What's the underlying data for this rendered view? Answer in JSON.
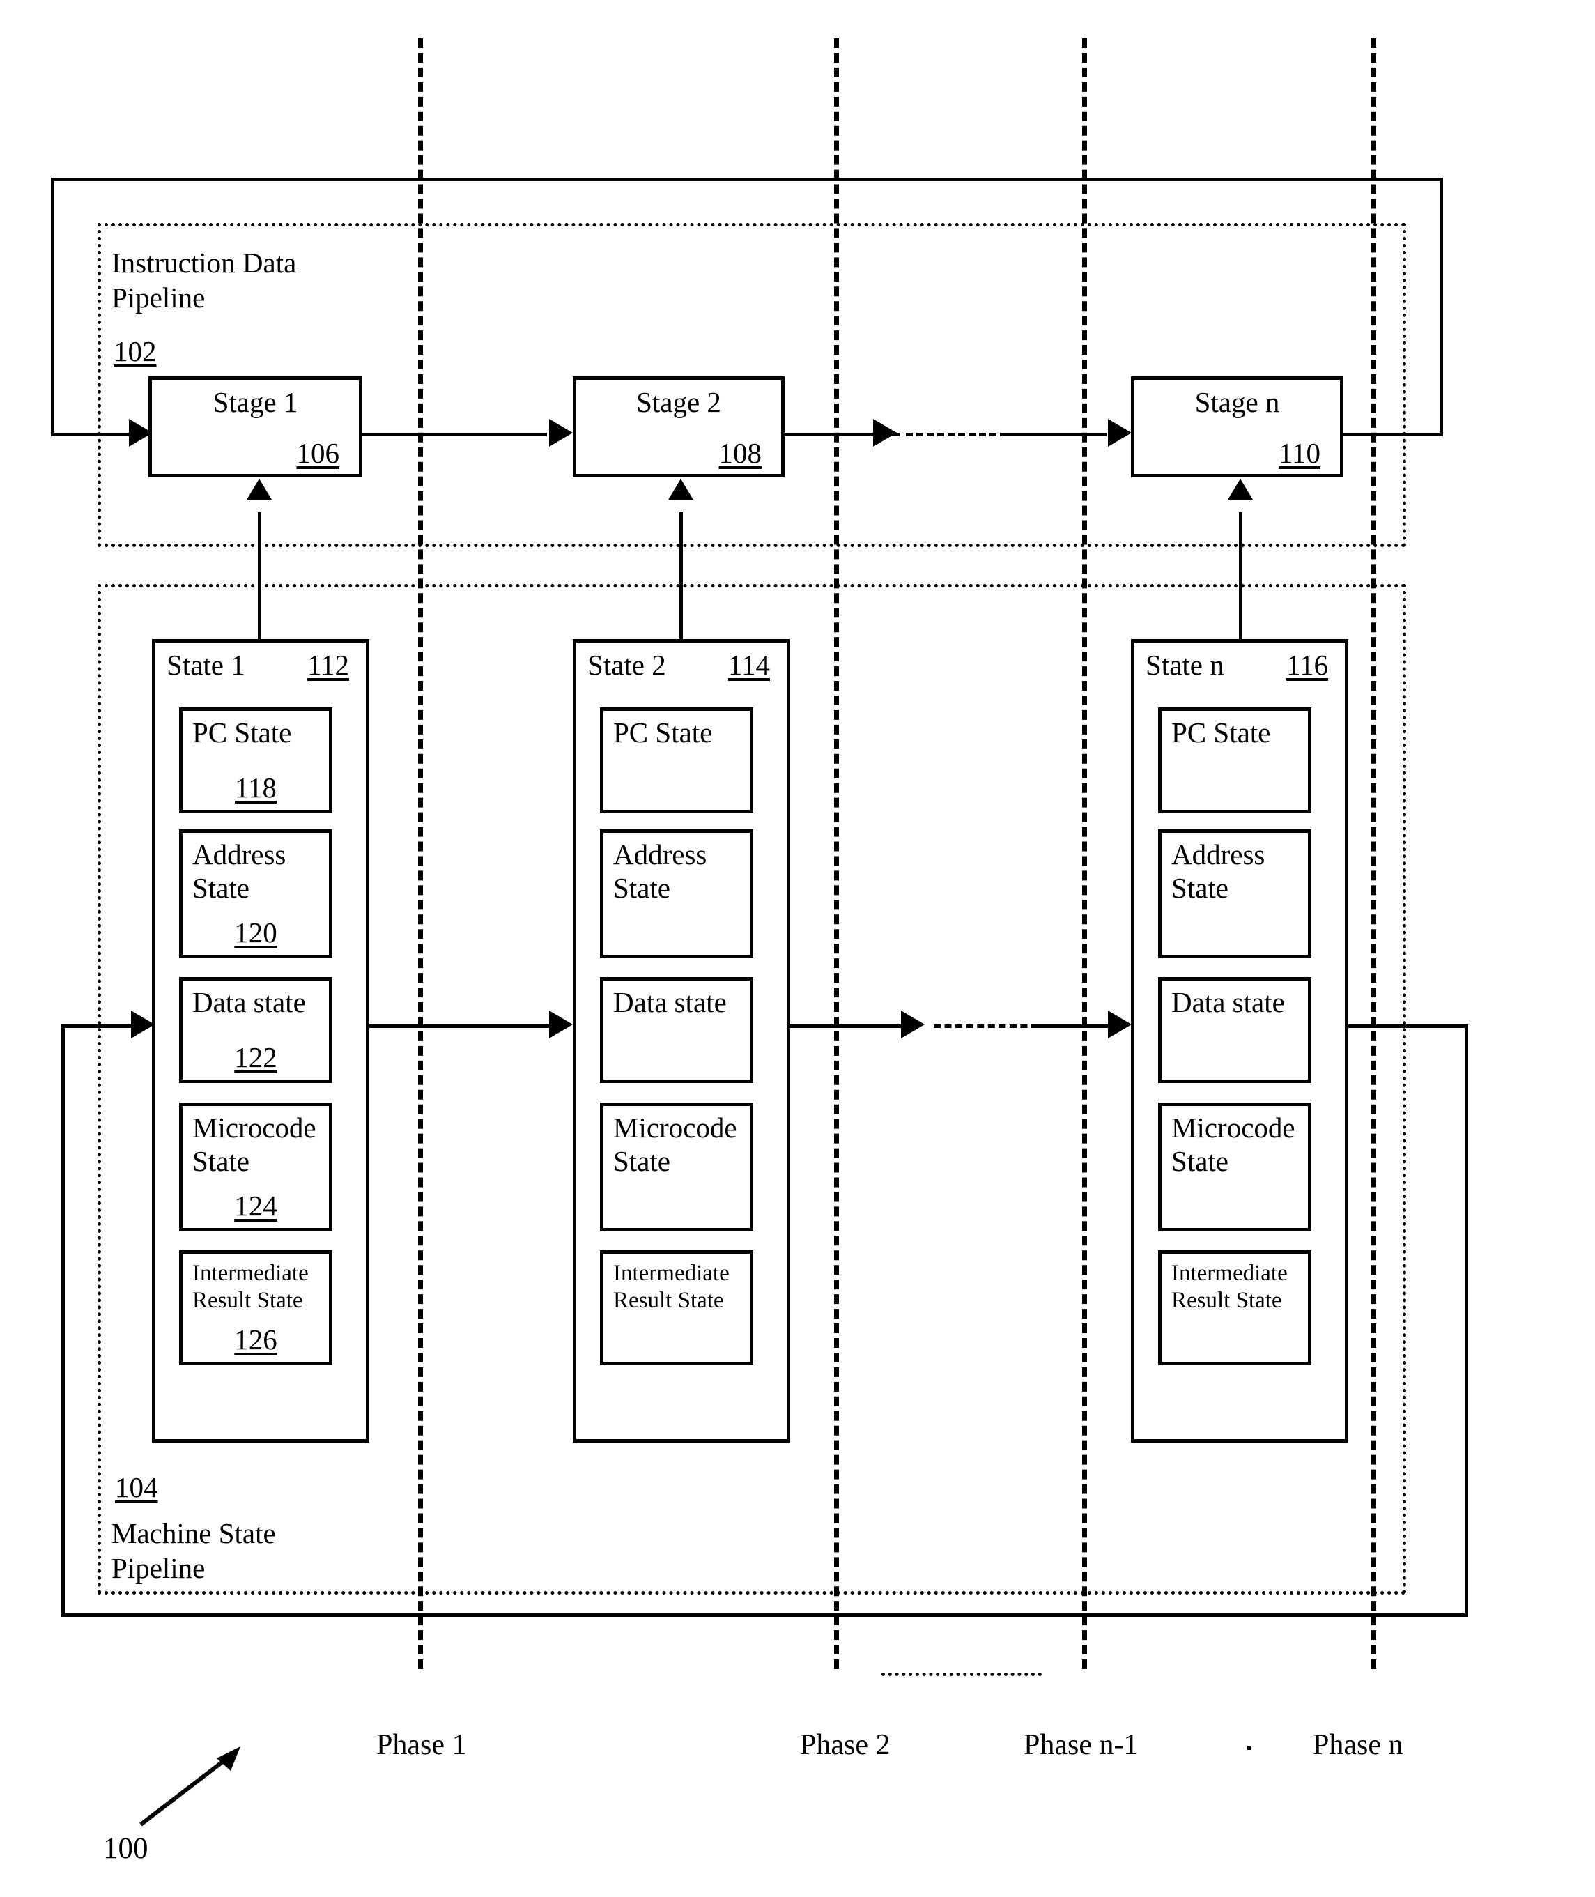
{
  "figure": {
    "figure_ref": "100",
    "instruction_pipeline": {
      "title": "Instruction Data\nPipeline",
      "ref": "102"
    },
    "machine_pipeline": {
      "ref": "104",
      "title": "Machine State\nPipeline"
    },
    "stages": [
      {
        "label": "Stage 1",
        "ref": "106"
      },
      {
        "label": "Stage 2",
        "ref": "108"
      },
      {
        "label": "Stage n",
        "ref": "110"
      }
    ],
    "states": [
      {
        "label": "State 1",
        "ref": "112",
        "fields": [
          {
            "name": "PC State",
            "ref": "118"
          },
          {
            "name": "Address\nState",
            "ref": "120"
          },
          {
            "name": "Data state",
            "ref": "122"
          },
          {
            "name": "Microcode\nState",
            "ref": "124"
          },
          {
            "name": "Intermediate\nResult State",
            "ref": "126"
          }
        ]
      },
      {
        "label": "State 2",
        "ref": "114",
        "fields": [
          {
            "name": "PC State",
            "ref": ""
          },
          {
            "name": "Address\nState",
            "ref": ""
          },
          {
            "name": "Data state",
            "ref": ""
          },
          {
            "name": "Microcode\nState",
            "ref": ""
          },
          {
            "name": "Intermediate\nResult State",
            "ref": ""
          }
        ]
      },
      {
        "label": "State n",
        "ref": "116",
        "fields": [
          {
            "name": "PC State",
            "ref": ""
          },
          {
            "name": "Address\nState",
            "ref": ""
          },
          {
            "name": "Data state",
            "ref": ""
          },
          {
            "name": "Microcode\nState",
            "ref": ""
          },
          {
            "name": "Intermediate\nResult State",
            "ref": ""
          }
        ]
      }
    ],
    "phases": [
      {
        "label": "Phase 1"
      },
      {
        "label": "Phase 2"
      },
      {
        "label": "Phase n-1"
      },
      {
        "label": "Phase n"
      }
    ]
  }
}
